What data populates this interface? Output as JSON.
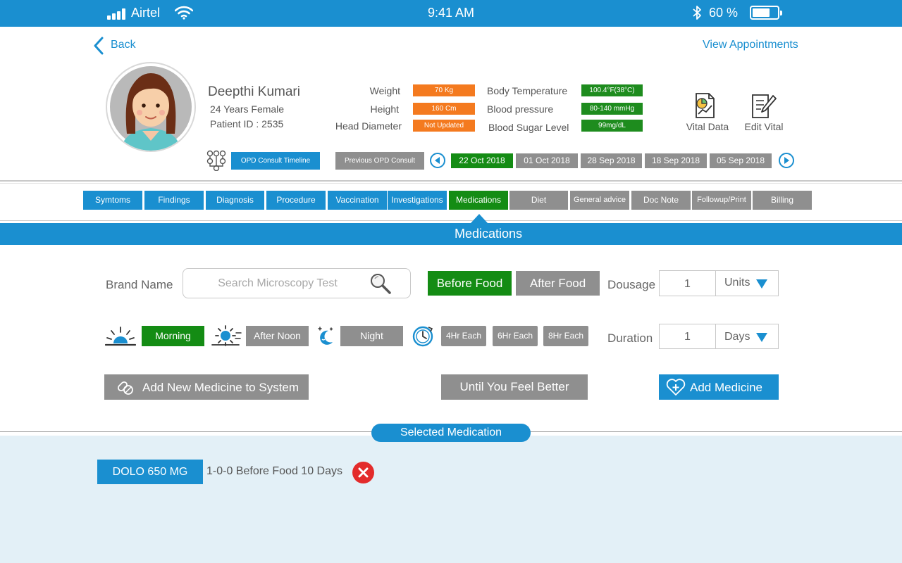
{
  "status_bar": {
    "carrier": "Airtel",
    "time": "9:41 AM",
    "battery_percent": "60 %",
    "battery_level": 0.6
  },
  "nav": {
    "back_label": "Back",
    "view_appointments_label": "View Appointments"
  },
  "patient": {
    "name": "Deepthi Kumari",
    "age_gender": "24 Years Female",
    "patient_id": "Patient ID : 2535"
  },
  "vitals": {
    "left": [
      {
        "label": "Weight",
        "value": "70 Kg"
      },
      {
        "label": "Height",
        "value": "160 Cm"
      },
      {
        "label": "Head Diameter",
        "value": "Not Updated"
      }
    ],
    "right": [
      {
        "label": "Body Temperature",
        "value": "100.4°F(38°C)"
      },
      {
        "label": "Blood pressure",
        "value": "80-140 mmHg"
      },
      {
        "label": "Blood Sugar Level",
        "value": "99mg/dL"
      }
    ],
    "vital_data_label": "Vital Data",
    "edit_vital_label": "Edit Vital"
  },
  "timeline": {
    "opd_timeline_label": "OPD Consult Timeline",
    "previous_opd_label": "Previous OPD Consult",
    "dates": [
      "22 Oct 2018",
      "01 Oct 2018",
      "28 Sep 2018",
      "18 Sep 2018",
      "05 Sep 2018"
    ],
    "active_date": "22 Oct 2018"
  },
  "tabs": {
    "items": [
      "Symtoms",
      "Findings",
      "Diagnosis",
      "Procedure",
      "Vaccination",
      "Investigations",
      "Medications",
      "Diet",
      "General advice",
      "Doc Note",
      "Followup/Print",
      "Billing"
    ],
    "active": "Medications"
  },
  "section_title": "Medications",
  "form": {
    "brand_name_label": "Brand Name",
    "search_placeholder": "Search Microscopy Test",
    "before_food_label": "Before Food",
    "after_food_label": "After Food",
    "dosage_label": "Dousage",
    "dosage_value": "1",
    "dosage_unit": "Units",
    "duration_label": "Duration",
    "duration_value": "1",
    "duration_unit": "Days",
    "morning_label": "Morning",
    "afternoon_label": "After Noon",
    "night_label": "Night",
    "intervals": [
      "4Hr Each",
      "6Hr Each",
      "8Hr Each"
    ],
    "add_new_medicine_label": "Add New Medicine to System",
    "until_better_label": "Until You Feel Better",
    "add_medicine_label": "Add Medicine"
  },
  "selected": {
    "title": "Selected Medication",
    "items": [
      {
        "name": "DOLO 650 MG",
        "detail": "1-0-0 Before Food 10 Days"
      }
    ]
  },
  "colors": {
    "brand_blue": "#1a8fd0",
    "active_green": "#148c14",
    "vital_orange": "#f47a1f",
    "inactive_gray": "#8f8f8f",
    "delete_red": "#e32b2b"
  }
}
